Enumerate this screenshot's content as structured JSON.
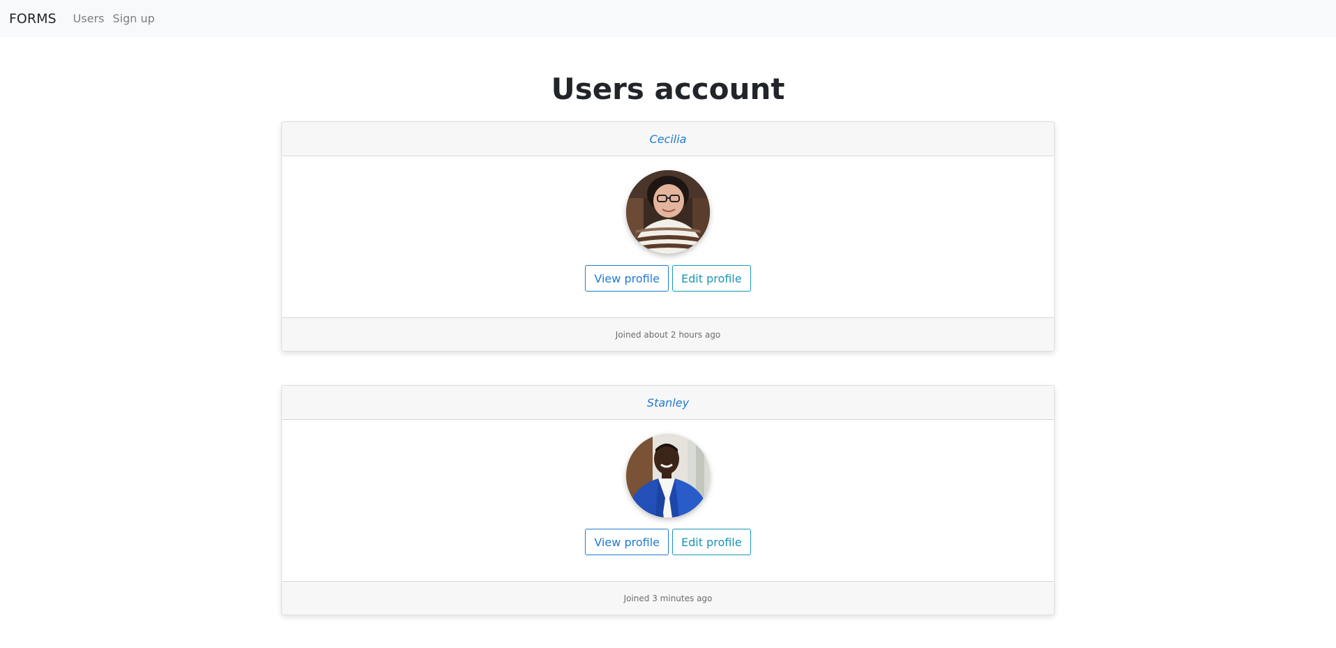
{
  "navbar": {
    "brand": "FORMS",
    "links": [
      "Users",
      "Sign up"
    ]
  },
  "page": {
    "title": "Users account"
  },
  "users": [
    {
      "name": "Cecilia",
      "view_label": "View profile",
      "edit_label": "Edit profile",
      "joined": "Joined about 2 hours ago"
    },
    {
      "name": "Stanley",
      "view_label": "View profile",
      "edit_label": "Edit profile",
      "joined": "Joined 3 minutes ago"
    }
  ],
  "colors": {
    "primary": "#1f7ad1",
    "info": "#1795b4",
    "navbar_bg": "#f8f9fa",
    "card_header_bg": "#f7f7f7"
  },
  "icons": {
    "avatar": "user-photo"
  }
}
